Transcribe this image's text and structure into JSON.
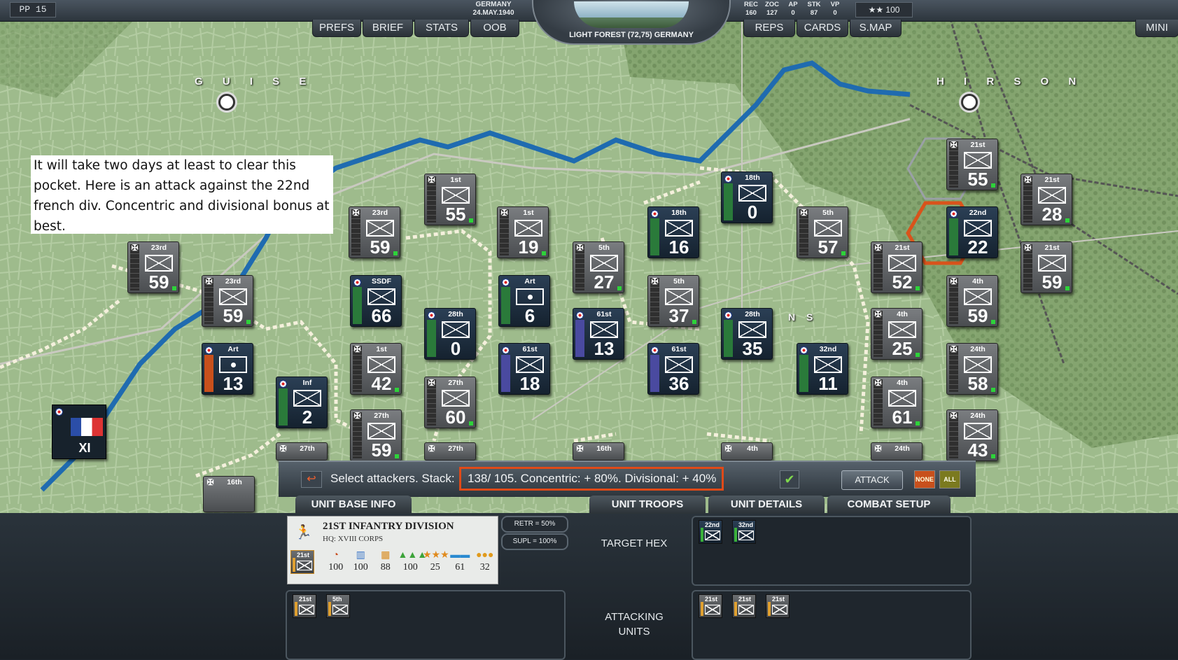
{
  "topbar": {
    "pp": "PP 15",
    "country": "GERMANY",
    "date": "24.MAY.1940",
    "menu_left": [
      "PREFS",
      "BRIEF",
      "STATS",
      "OOB"
    ],
    "menu_right": [
      "REPS",
      "CARDS",
      "S.MAP"
    ],
    "mini": "MINI",
    "terrain_label": "LIGHT FOREST (72,75) GERMANY",
    "stats": [
      {
        "label": "REC",
        "value": "160"
      },
      {
        "label": "ZOC",
        "value": "127"
      },
      {
        "label": "AP",
        "value": "0"
      },
      {
        "label": "STK",
        "value": "87"
      },
      {
        "label": "VP",
        "value": "0"
      }
    ],
    "stars": "★★ 100"
  },
  "map": {
    "cities": [
      "G U I S E",
      "H I R S O N"
    ],
    "fragment_label": "N S",
    "note": "It will take two days at least to clear this pocket. Here is an attack against the 22nd french div. Concentric and divisional bonus at best.",
    "corps_label": "XI",
    "counters": [
      {
        "name": "23rd",
        "num": "59",
        "side": "de"
      },
      {
        "name": "23rd",
        "num": "59",
        "side": "de"
      },
      {
        "name": "23rd",
        "num": "59",
        "side": "de"
      },
      {
        "name": "1st",
        "num": "55",
        "side": "de"
      },
      {
        "name": "1st",
        "num": "19",
        "side": "de"
      },
      {
        "name": "5th",
        "num": "27",
        "side": "de"
      },
      {
        "name": "18th",
        "num": "16",
        "side": "fr"
      },
      {
        "name": "18th",
        "num": "0",
        "side": "fr"
      },
      {
        "name": "5th",
        "num": "57",
        "side": "de"
      },
      {
        "name": "21st",
        "num": "55",
        "side": "de"
      },
      {
        "name": "21st",
        "num": "28",
        "side": "de"
      },
      {
        "name": "22nd",
        "num": "22",
        "side": "fr"
      },
      {
        "name": "21st",
        "num": "52",
        "side": "de"
      },
      {
        "name": "21st",
        "num": "59",
        "side": "de"
      },
      {
        "name": "SSDF",
        "num": "66",
        "side": "fr"
      },
      {
        "name": "Art",
        "num": "6",
        "side": "fr"
      },
      {
        "name": "5th",
        "num": "37",
        "side": "de"
      },
      {
        "name": "4th",
        "num": "59",
        "side": "de"
      },
      {
        "name": "Art",
        "num": "13",
        "side": "fr"
      },
      {
        "name": "28th",
        "num": "0",
        "side": "fr"
      },
      {
        "name": "61st",
        "num": "13",
        "side": "fr"
      },
      {
        "name": "28th",
        "num": "35",
        "side": "fr"
      },
      {
        "name": "4th",
        "num": "25",
        "side": "de"
      },
      {
        "name": "1st",
        "num": "42",
        "side": "de"
      },
      {
        "name": "61st",
        "num": "18",
        "side": "fr"
      },
      {
        "name": "61st",
        "num": "36",
        "side": "fr"
      },
      {
        "name": "32nd",
        "num": "11",
        "side": "fr"
      },
      {
        "name": "24th",
        "num": "58",
        "side": "de"
      },
      {
        "name": "Inf",
        "num": "2",
        "side": "fr"
      },
      {
        "name": "27th",
        "num": "60",
        "side": "de"
      },
      {
        "name": "4th",
        "num": "61",
        "side": "de"
      },
      {
        "name": "27th",
        "num": "59",
        "side": "de"
      },
      {
        "name": "24th",
        "num": "43",
        "side": "de"
      }
    ],
    "partial_counters": [
      "27th",
      "27th",
      "16th",
      "4th",
      "24th",
      "16th"
    ]
  },
  "command": {
    "message_prefix": "Select attackers. Stack:",
    "message_highlight": "138/ 105. Concentric: + 80%. Divisional: + 40%",
    "attack": "ATTACK",
    "none": "NONE",
    "all": "ALL"
  },
  "tabs": [
    "UNIT BASE INFO",
    "UNIT TROOPS",
    "UNIT DETAILS",
    "COMBAT SETUP"
  ],
  "unit": {
    "title": "21ST INFANTRY DIVISION",
    "hq": "HQ: XVIII CORPS",
    "counter": "21st",
    "ratings": [
      "100",
      "100",
      "88",
      "100",
      "25",
      "61",
      "32"
    ],
    "retr": "RETR = 50%",
    "supl": "SUPL = 100%"
  },
  "target": {
    "label": "TARGET HEX",
    "units": [
      "22nd",
      "32nd"
    ]
  },
  "attacking": {
    "label": "ATTACKING UNITS",
    "selected": [
      "21st",
      "5th"
    ],
    "available": [
      "21st",
      "21st",
      "21st"
    ]
  }
}
